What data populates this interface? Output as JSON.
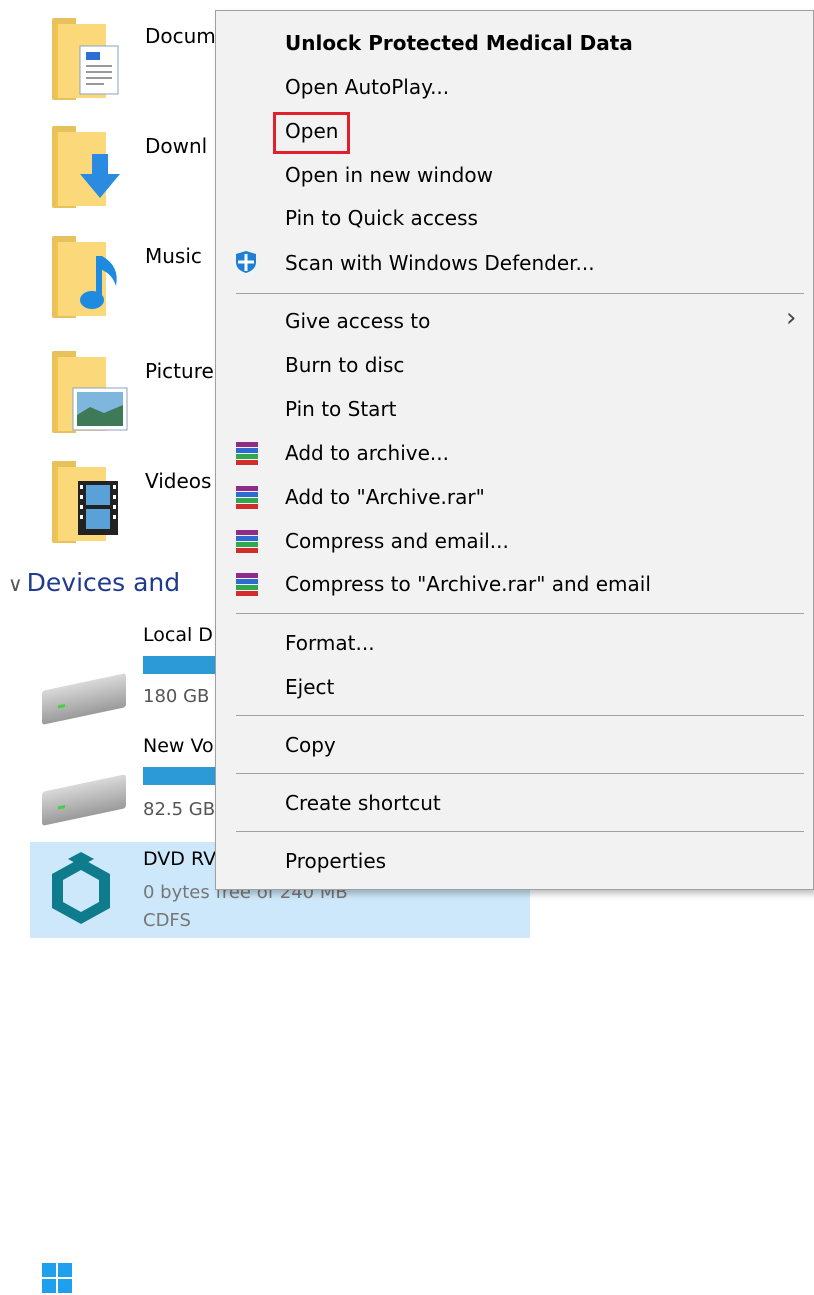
{
  "explorer": {
    "folders": [
      {
        "label": "Docum",
        "icon": "documents-folder-icon"
      },
      {
        "label": "Downl",
        "icon": "downloads-folder-icon"
      },
      {
        "label": "Music",
        "icon": "music-folder-icon"
      },
      {
        "label": "Picture",
        "icon": "pictures-folder-icon"
      },
      {
        "label": "Videos",
        "icon": "videos-folder-icon"
      }
    ],
    "section_header": "Devices and",
    "drives": [
      {
        "label": "Local D",
        "size": "180 GB"
      },
      {
        "label": "New Vo",
        "size": "82.5 GB"
      },
      {
        "label": "DVD RV",
        "size": "0 bytes free of 240 MB",
        "fs": "CDFS"
      }
    ]
  },
  "context_menu": {
    "items": [
      {
        "label": "Unlock Protected Medical Data",
        "bold": true
      },
      {
        "label": "Open AutoPlay..."
      },
      {
        "label": "Open",
        "highlighted": true
      },
      {
        "label": "Open in new window"
      },
      {
        "label": "Pin to Quick access"
      },
      {
        "label": "Scan with Windows Defender...",
        "icon": "windows-defender-icon"
      },
      {
        "label": "Give access to",
        "submenu": true
      },
      {
        "label": "Burn to disc"
      },
      {
        "label": "Pin to Start"
      },
      {
        "label": "Add to archive...",
        "icon": "winrar-icon"
      },
      {
        "label": "Add to \"Archive.rar\"",
        "icon": "winrar-icon"
      },
      {
        "label": "Compress and email...",
        "icon": "winrar-icon"
      },
      {
        "label": "Compress to \"Archive.rar\" and email",
        "icon": "winrar-icon"
      },
      {
        "label": "Format..."
      },
      {
        "label": "Eject"
      },
      {
        "label": "Copy"
      },
      {
        "label": "Create shortcut"
      },
      {
        "label": "Properties"
      }
    ],
    "highlight_color": "#e0202a"
  }
}
